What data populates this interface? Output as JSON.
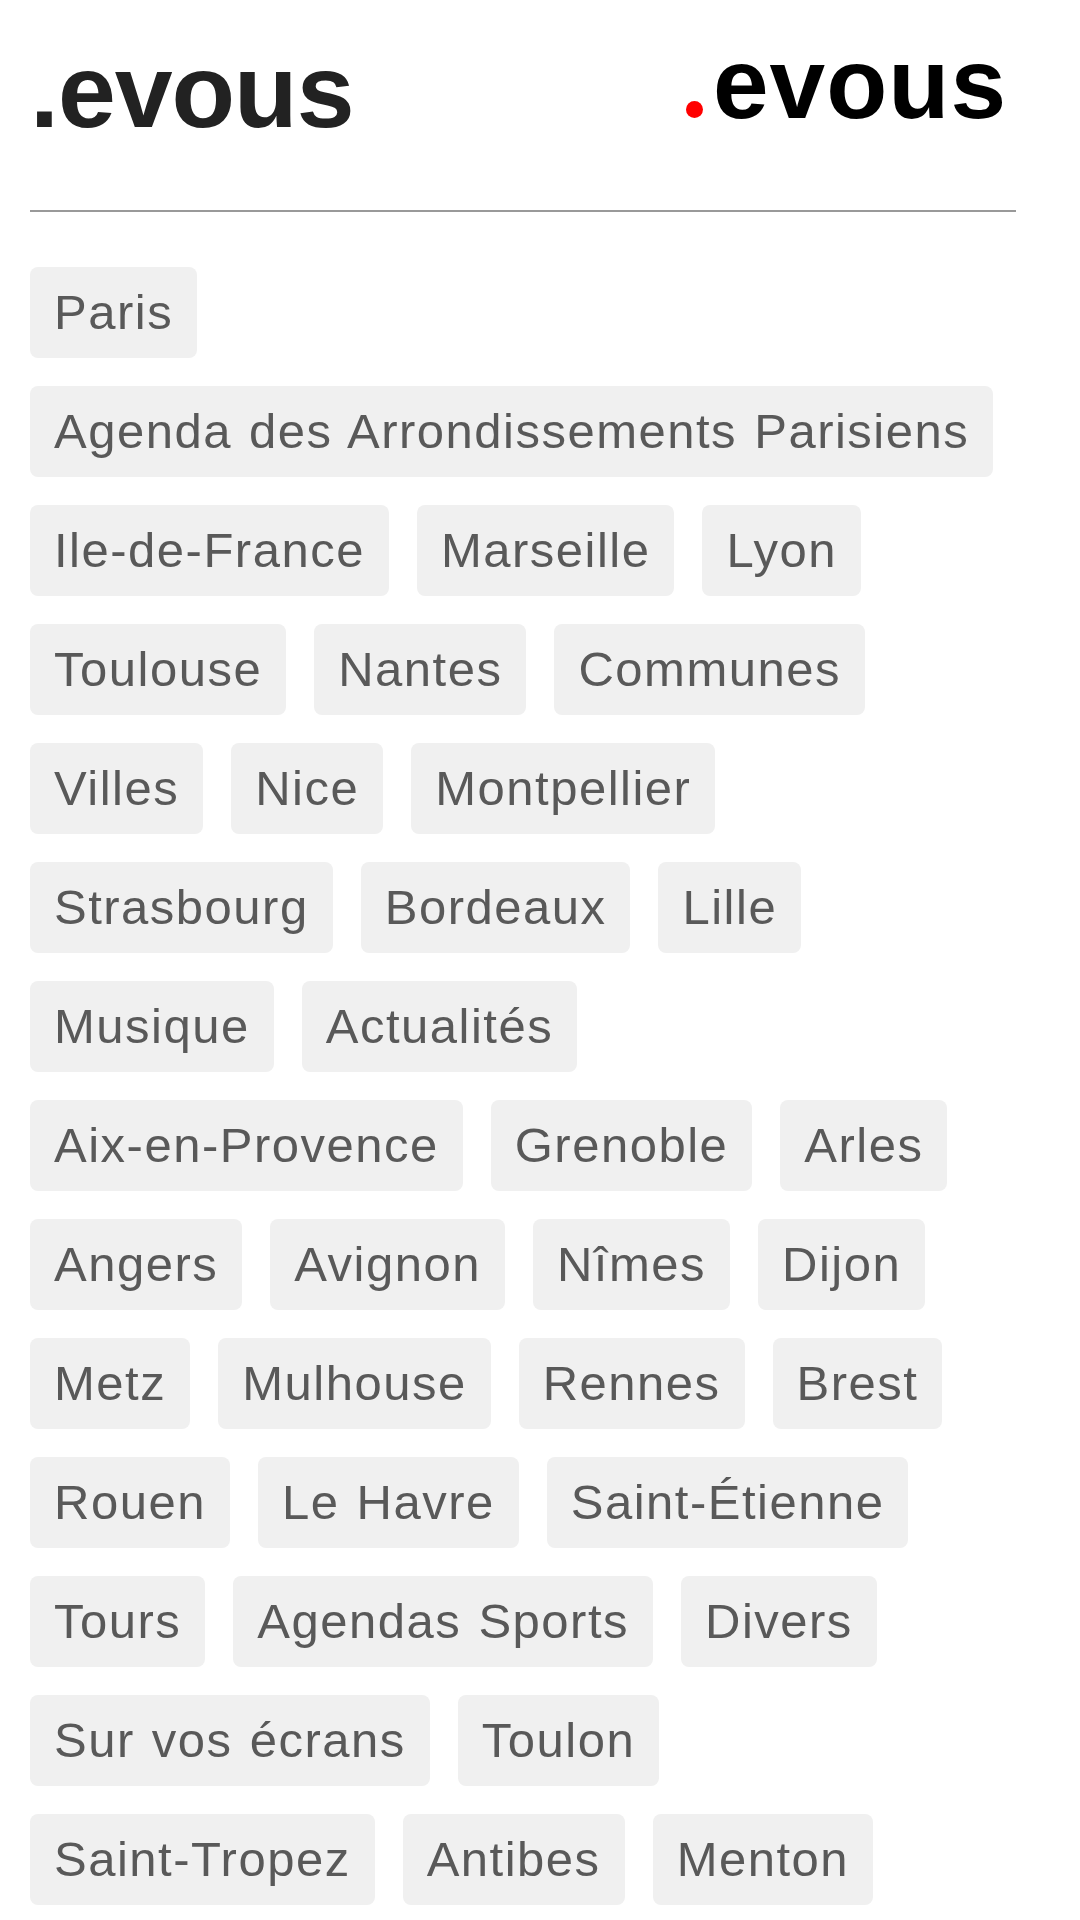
{
  "header": {
    "title": ".evous",
    "logo": {
      "text": "evous"
    }
  },
  "tags": [
    "Paris",
    "Agenda des Arrondissements Parisiens",
    "Ile-de-France",
    "Marseille",
    "Lyon",
    "Toulouse",
    "Nantes",
    "Communes",
    "Villes",
    "Nice",
    "Montpellier",
    "Strasbourg",
    "Bordeaux",
    "Lille",
    "Musique",
    "Actualités",
    "Aix-en-Provence",
    "Grenoble",
    "Arles",
    "Angers",
    "Avignon",
    "Nîmes",
    "Dijon",
    "Metz",
    "Mulhouse",
    "Rennes",
    "Brest",
    "Rouen",
    "Le Havre",
    "Saint-Étienne",
    "Tours",
    "Agendas Sports",
    "Divers",
    "Sur vos écrans",
    "Toulon",
    "Saint-Tropez",
    "Antibes",
    "Menton"
  ]
}
